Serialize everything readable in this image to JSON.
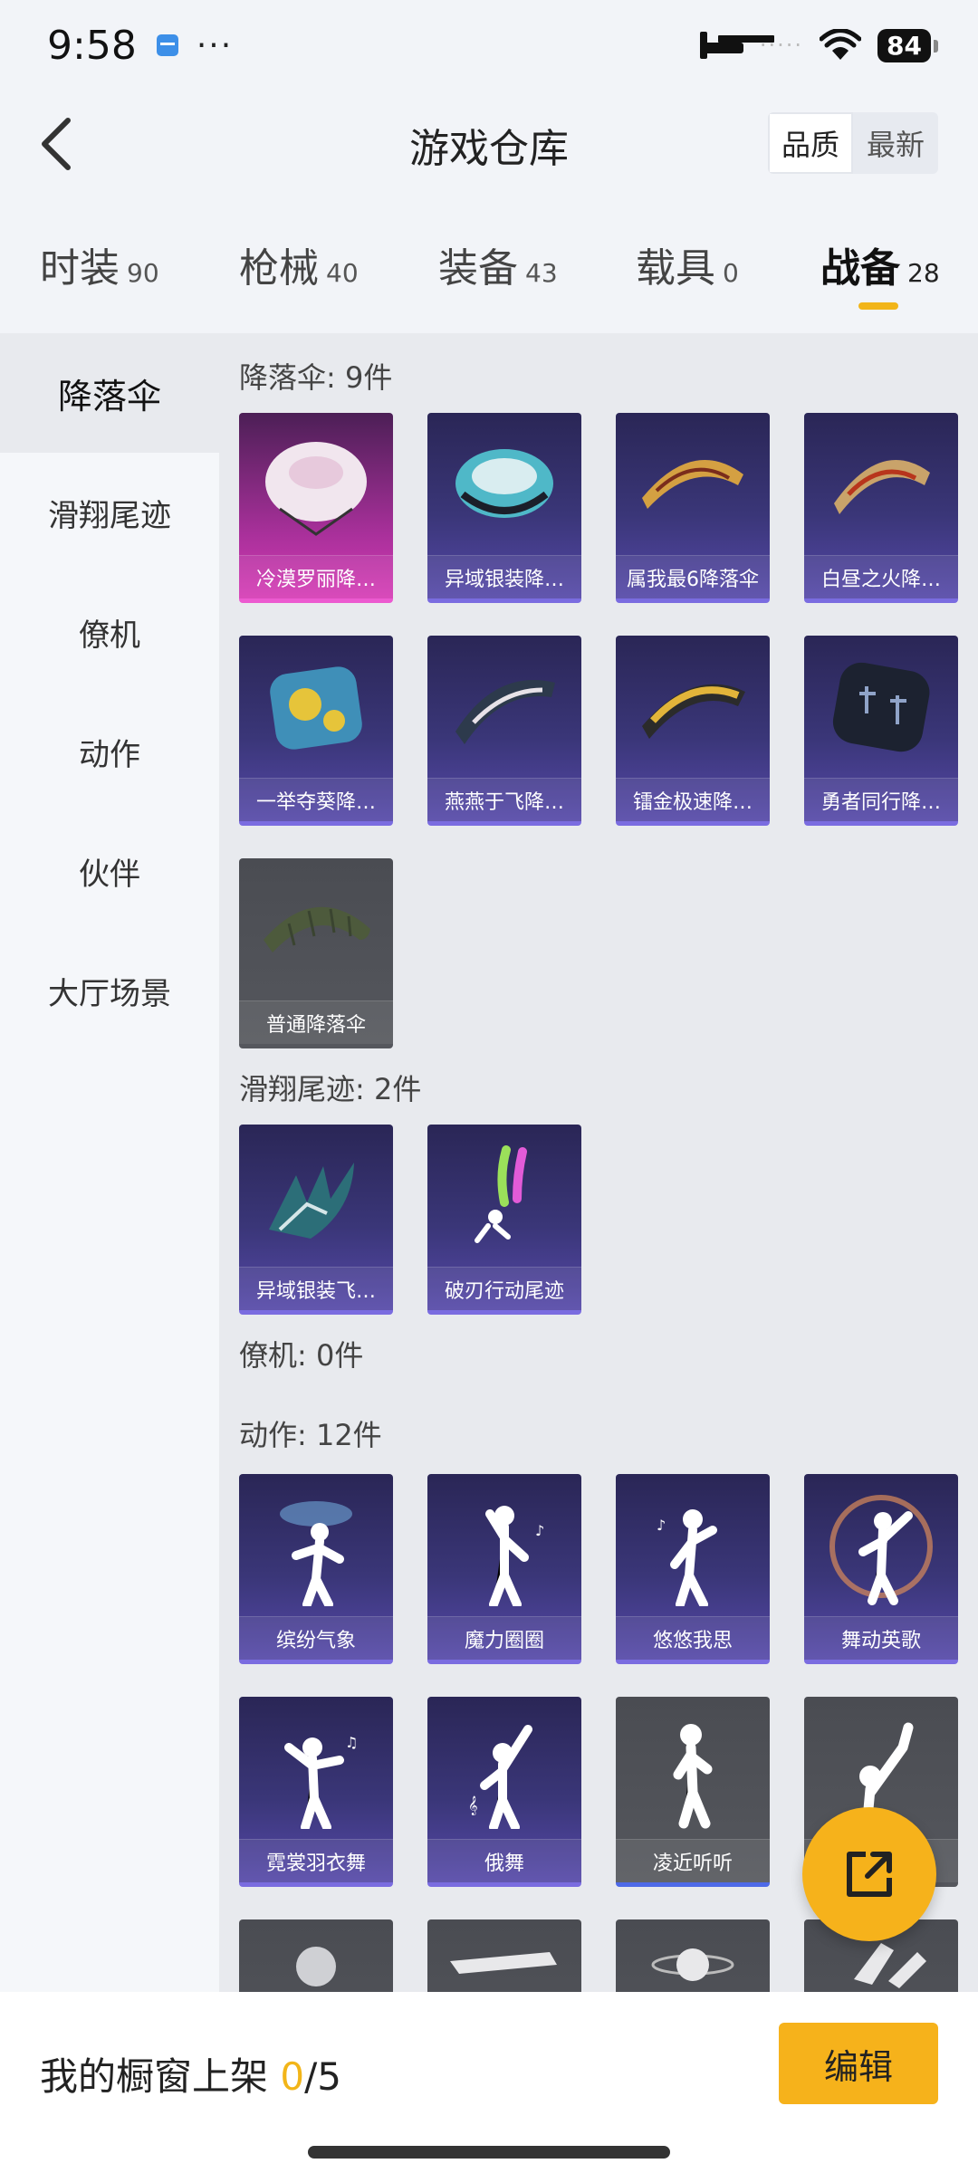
{
  "status_bar": {
    "time": "9:58",
    "battery": "84",
    "more": "···",
    "signal": "·····"
  },
  "header": {
    "title": "游戏仓库",
    "sort_options": [
      "品质",
      "最新"
    ],
    "sort_active": "品质"
  },
  "tabs": [
    {
      "label": "时装",
      "count": "90"
    },
    {
      "label": "枪械",
      "count": "40"
    },
    {
      "label": "装备",
      "count": "43"
    },
    {
      "label": "载具",
      "count": "0"
    },
    {
      "label": "战备",
      "count": "28"
    }
  ],
  "active_tab": "战备",
  "sidebar": {
    "items": [
      "降落伞",
      "滑翔尾迹",
      "僚机",
      "动作",
      "伙伴",
      "大厅场景"
    ],
    "active": "降落伞"
  },
  "sections": {
    "parachute": {
      "title": "降落伞: 9件",
      "items": [
        "冷漠罗丽降…",
        "异域银装降…",
        "属我最6降落伞",
        "白昼之火降…",
        "一举夺葵降…",
        "燕燕于飞降…",
        "镭金极速降…",
        "勇者同行降…",
        "普通降落伞"
      ]
    },
    "trail": {
      "title": "滑翔尾迹: 2件",
      "items": [
        "异域银装飞…",
        "破刃行动尾迹"
      ]
    },
    "wingman": {
      "title": "僚机: 0件"
    },
    "emote": {
      "title": "动作: 12件",
      "items": [
        "缤纷气象",
        "魔力圈圈",
        "悠悠我思",
        "舞动英歌",
        "霓裳羽衣舞",
        "俄舞",
        "凌近听听",
        ""
      ]
    }
  },
  "bottom_bar": {
    "showcase_label": "我的橱窗上架",
    "showcase_count": "0",
    "showcase_total": "/5",
    "edit_label": "编辑"
  },
  "colors": {
    "accent": "#f6b21b",
    "card_purple": "#3a3678",
    "card_pink": "#d63bb5",
    "card_gray": "#55575d"
  }
}
